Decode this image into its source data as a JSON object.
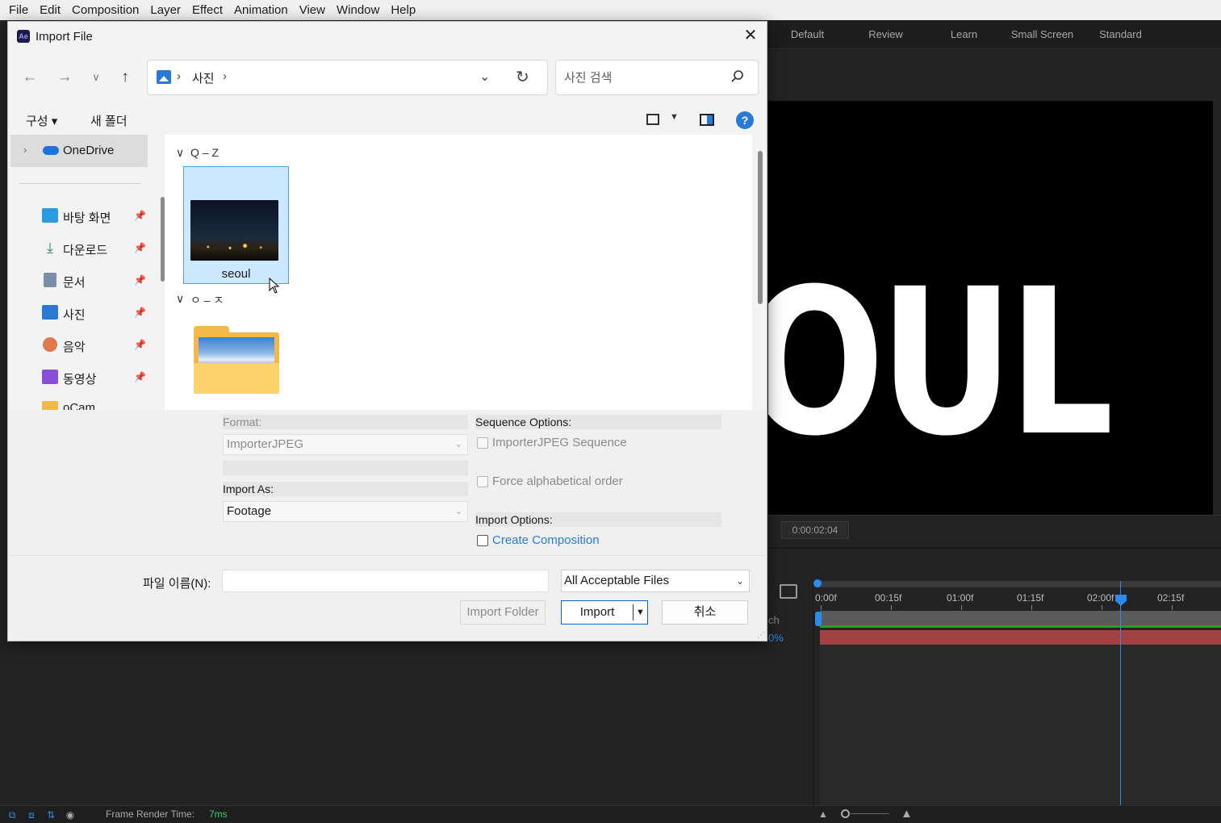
{
  "menubar": {
    "items": [
      "File",
      "Edit",
      "Composition",
      "Layer",
      "Effect",
      "Animation",
      "View",
      "Window",
      "Help"
    ]
  },
  "workspaces": [
    "Default",
    "Review",
    "Learn",
    "Small Screen",
    "Standard"
  ],
  "viewer": {
    "comp_text": "OUL",
    "timecode": "0:00:02:04"
  },
  "timeline": {
    "ruler_labels": [
      "0:00f",
      "00:15f",
      "01:00f",
      "01:15f",
      "02:00f",
      "02:15f"
    ],
    "partial_text": "ch",
    "partial_percent": "0%"
  },
  "statusbar": {
    "frame_render_label": "Frame Render Time:",
    "frame_render_value": "7ms"
  },
  "dialog": {
    "title": "Import File",
    "app_icon": "Ae",
    "address": {
      "path": "사진",
      "sep": "›"
    },
    "search": {
      "placeholder": "사진 검색"
    },
    "commands": {
      "organize": "구성 ▾",
      "new_folder": "새 폴더"
    },
    "nav": {
      "onedrive": "OneDrive",
      "items": [
        {
          "label": "바탕 화면",
          "icon": "desktop-icon",
          "color": "#2a9be0"
        },
        {
          "label": "다운로드",
          "icon": "download-icon",
          "color": "#1f8a70"
        },
        {
          "label": "문서",
          "icon": "document-icon",
          "color": "#7b8ea8"
        },
        {
          "label": "사진",
          "icon": "pictures-icon",
          "color": "#2a7ad5"
        },
        {
          "label": "음악",
          "icon": "music-icon",
          "color": "#e2784d"
        },
        {
          "label": "동영상",
          "icon": "video-icon",
          "color": "#8a4fd8"
        },
        {
          "label": "oCam",
          "icon": "folder-icon",
          "color": "#f2b84a"
        }
      ]
    },
    "groups": [
      {
        "header": "Q – Z"
      },
      {
        "header": "ㅇ – ㅈ"
      }
    ],
    "files": [
      {
        "name": "seoul"
      }
    ],
    "options": {
      "format_label": "Format:",
      "format_value": "ImporterJPEG",
      "import_as_label": "Import As:",
      "import_as_value": "Footage",
      "sequence_label": "Sequence Options:",
      "sequence_checkbox": "ImporterJPEG Sequence",
      "alpha_checkbox": "Force alphabetical order",
      "import_options_label": "Import Options:",
      "create_comp_checkbox": "Create Composition"
    },
    "footer": {
      "filename_label": "파일 이름(N):",
      "filename_value": "",
      "filter_value": "All Acceptable Files",
      "import_folder": "Import Folder",
      "import": "Import",
      "cancel": "취소"
    }
  }
}
